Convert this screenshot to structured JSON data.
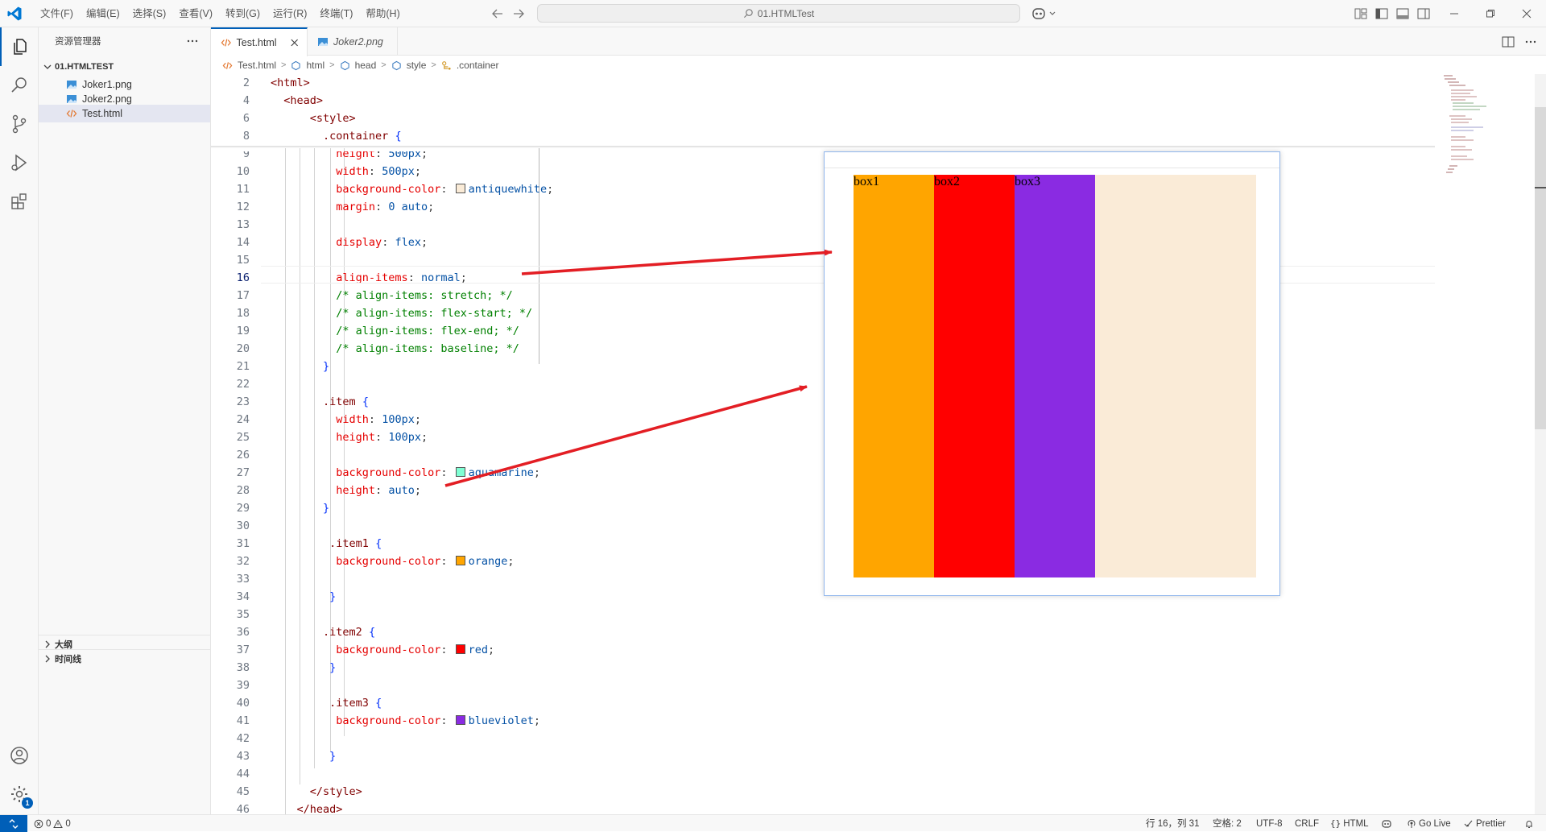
{
  "menu": [
    "文件(F)",
    "编辑(E)",
    "选择(S)",
    "查看(V)",
    "转到(G)",
    "运行(R)",
    "终端(T)",
    "帮助(H)"
  ],
  "search": {
    "label": "01.HTMLTest"
  },
  "sidebar": {
    "title": "资源管理器",
    "folder": "01.HTMLTEST",
    "files": [
      {
        "name": "Joker1.png",
        "icon": "image-file-icon"
      },
      {
        "name": "Joker2.png",
        "icon": "image-file-icon"
      },
      {
        "name": "Test.html",
        "icon": "html-file-icon",
        "selected": true
      }
    ],
    "sections": [
      "大纲",
      "时间线"
    ]
  },
  "tabs": [
    {
      "label": "Test.html",
      "active": true
    },
    {
      "label": "Joker2.png",
      "active": false
    }
  ],
  "breadcrumb": [
    "Test.html",
    "html",
    "head",
    "style",
    ".container"
  ],
  "preview": {
    "boxes": [
      "box1",
      "box2",
      "box3"
    ],
    "colors": [
      "#ffa500",
      "#ff0000",
      "#8a2be2"
    ],
    "container_color": "#faebd7"
  },
  "status": {
    "problems": {
      "errors": "0",
      "warnings": "0"
    },
    "position": "行 16，列 31",
    "indent": "空格: 2",
    "encoding": "UTF-8",
    "eol": "CRLF",
    "language": "HTML",
    "golive": "Go Live",
    "prettier": "Prettier",
    "notif_badge": "1"
  },
  "colors": {
    "accent": "#005fb8",
    "arrow": "#e31e24"
  }
}
